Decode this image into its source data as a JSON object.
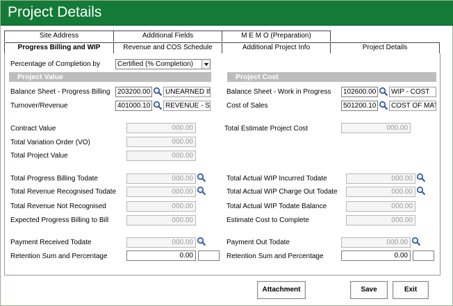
{
  "window": {
    "title": "Project Details"
  },
  "tabs_row1": [
    "Site Address",
    "Additional Fields",
    "M E M O  (Preparation)"
  ],
  "tabs_row2": [
    "Progress Billing and WIP",
    "Revenue and COS Schedule",
    "Additional Project Info",
    "Project  Details"
  ],
  "completion": {
    "label": "Percentage of Completion by",
    "value": "Certified (% Completion)"
  },
  "sections": {
    "value": "Project Value",
    "cost": "Project Cost"
  },
  "left": {
    "bs_progress_billing": {
      "label": "Balance Sheet - Progress Billing",
      "code": "203200.00",
      "name": "UNEARNED INC"
    },
    "turnover": {
      "label": "Turnover/Revenue",
      "code": "401000.10",
      "name": "REVENUE - SL"
    },
    "contract_value": {
      "label": "Contract Value",
      "value": "000.00"
    },
    "variation_order": {
      "label": "Total Variation Order (VO)",
      "value": "000.00"
    },
    "project_value": {
      "label": "Total Project Value",
      "value": "000.00"
    },
    "progress_billing_todate": {
      "label": "Total Progress Billing Todate",
      "value": "000.00"
    },
    "revenue_recognised": {
      "label": "Total Revenue Recognised Todate",
      "value": "000.00"
    },
    "revenue_not_recognised": {
      "label": "Total Revenue Not Recognised",
      "value": "000.00"
    },
    "expected_progress_billing": {
      "label": "Expected Progress Billing to Bill",
      "value": "000.00"
    },
    "payment_received": {
      "label": "Payment Received Todate",
      "value": "000.00"
    },
    "retention": {
      "label": "Retention Sum and Percentage",
      "value": "0.00",
      "pct": ""
    }
  },
  "right": {
    "bs_wip": {
      "label": "Balance Sheet - Work in Progress",
      "code": "102600.00",
      "name": "WIP - COST"
    },
    "cost_of_sales": {
      "label": "Cost of Sales",
      "code": "501200.10",
      "name": "COST OF MAT"
    },
    "estimate_cost": {
      "label": "Total Estimate Project Cost",
      "value": "000.00"
    },
    "wip_incurred": {
      "label": "Total Actual WIP Incurred Todate",
      "value": "000.00"
    },
    "wip_charge_out": {
      "label": "Total Actual WIP Charge Out Todate",
      "value": "000.00"
    },
    "wip_balance": {
      "label": "Total Actual WIP Todate Balance",
      "value": "000.00"
    },
    "cost_to_complete": {
      "label": "Estimate Cost to Complete",
      "value": "000.00"
    },
    "payment_out": {
      "label": "Payment Out Todate",
      "value": "000.00"
    },
    "retention": {
      "label": "Retention Sum and Percentage",
      "value": "0.00",
      "pct": ""
    }
  },
  "buttons": {
    "attachment": "Attachment",
    "save": "Save",
    "exit": "Exit"
  },
  "colors": {
    "titlebar": "#147a37",
    "section_bar": "#bdbdbd"
  }
}
